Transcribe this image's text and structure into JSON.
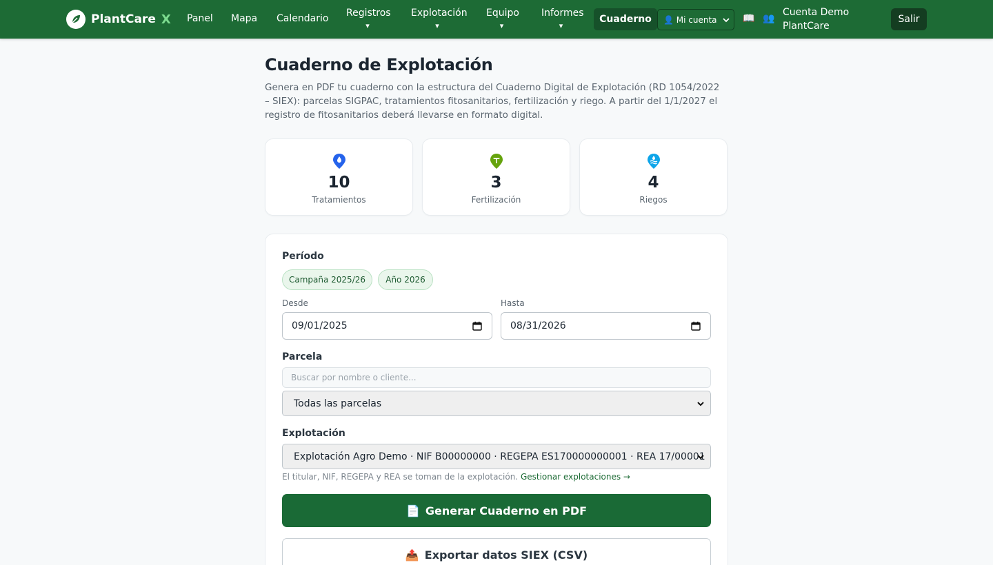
{
  "navbar": {
    "brand_name": "PlantCare",
    "brand_suffix": "X",
    "links": {
      "panel": "Panel",
      "mapa": "Mapa",
      "calendario": "Calendario"
    },
    "dropdowns": {
      "registros": "Registros",
      "explotacion": "Explotación",
      "equipo": "Equipo",
      "informes": "Informes",
      "caret": "▾"
    },
    "active": "Cuaderno",
    "account_select": "👤 Mi cuenta",
    "help_icon": "📖",
    "users_icon": "👥",
    "user_line1": "Cuenta Demo",
    "user_line2": "PlantCare",
    "logout": "Salir"
  },
  "header": {
    "title": "Cuaderno de Explotación",
    "description": "Genera en PDF tu cuaderno con la estructura del Cuaderno Digital de Explotación (RD 1054/2022 – SIEX): parcelas SIGPAC, tratamientos fitosanitarios, fertilización y riego. A partir del 1/1/2027 el registro de fitosanitarios deberá llevarse en formato digital."
  },
  "stats": [
    {
      "icon": "drop-pin-icon",
      "value": "10",
      "label": "Tratamientos",
      "color": "#2563eb"
    },
    {
      "icon": "plant-pin-icon",
      "value": "3",
      "label": "Fertilización",
      "color": "#65a30d"
    },
    {
      "icon": "water-pin-icon",
      "value": "4",
      "label": "Riegos",
      "color": "#0ea5e9"
    }
  ],
  "form": {
    "period_label": "Período",
    "chip_campaign": "Campaña 2025/26",
    "chip_year": "Año 2026",
    "from_label": "Desde",
    "from_value": "09/01/2025",
    "to_label": "Hasta",
    "to_value": "08/31/2026",
    "parcel_label": "Parcela",
    "parcel_search_placeholder": "Buscar por nombre o cliente...",
    "parcel_selected": "Todas las parcelas",
    "exploitation_label": "Explotación",
    "exploitation_selected": "Explotación Agro Demo · NIF B00000000 · REGEPA ES170000000001 · REA 17/00001",
    "hint_text": "El titular, NIF, REGEPA y REA se toman de la explotación.",
    "hint_link": "Gestionar explotaciones →",
    "generate_icon": "📄",
    "generate_label": "Generar Cuaderno en PDF",
    "export_icon": "📤",
    "export_label": "Exportar datos SIEX (CSV)"
  },
  "colors": {
    "nav_green": "#1d6b35",
    "primary_button": "#1a6a36",
    "chip_bg": "#eaf6ec"
  }
}
